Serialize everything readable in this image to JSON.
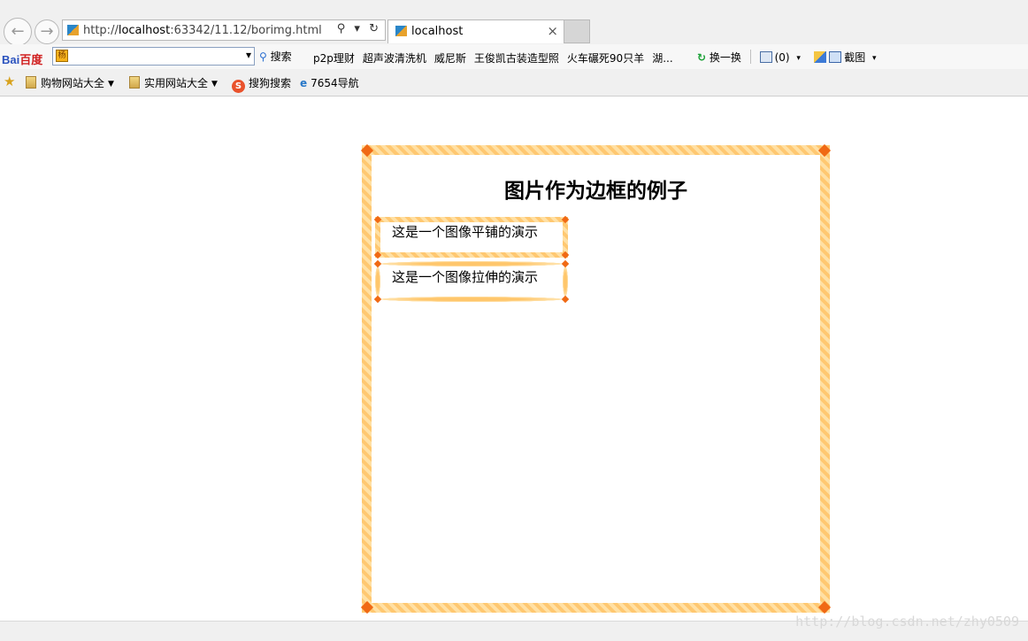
{
  "browser": {
    "address": {
      "url_prefix": "http://",
      "host": "localhost",
      "url_rest": ":63342/11.12/borimg.html",
      "icons": "⚲ ▾ ↻"
    },
    "tab": {
      "title": "localhost",
      "close": "×"
    },
    "search": {
      "brand_a": "Bai",
      "brand_b": "百度",
      "logo": "杨",
      "button_label": "搜索",
      "dropdown": "▾"
    },
    "links": [
      "p2p理财",
      "超声波清洗机",
      "威尼斯",
      "王俊凯古装造型照",
      "火车碾死90只羊",
      "湖..."
    ],
    "tools": {
      "refresh_label": "换一换",
      "count_label": "(0)",
      "screenshot_label": "截图"
    },
    "favorites": [
      {
        "label": "购物网站大全"
      },
      {
        "label": "实用网站大全"
      },
      {
        "label": "搜狗搜索"
      },
      {
        "label": "7654导航"
      }
    ]
  },
  "page": {
    "title": "图片作为边框的例子",
    "demo_round": "这是一个图像平铺的演示",
    "demo_stretch": "这是一个图像拉伸的演示"
  },
  "watermark": "http://blog.csdn.net/zhy0509"
}
